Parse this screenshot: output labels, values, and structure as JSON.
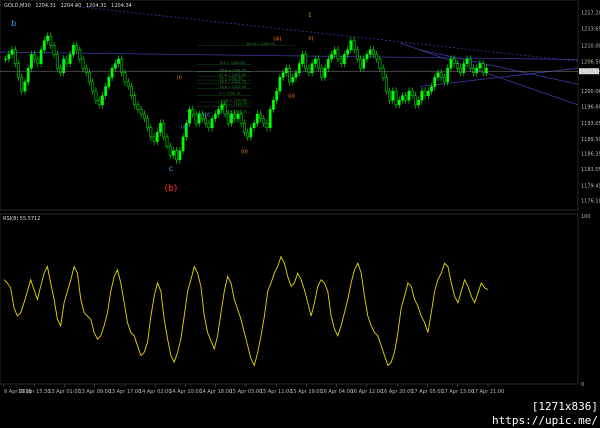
{
  "window": {
    "symbol_label": "GOLD,M30",
    "ohlc": [
      "1204.31",
      "1204.40",
      "1204.31",
      "1204.34"
    ]
  },
  "indicator": {
    "label": "RSI(8) 55.5712",
    "top_label": "100",
    "bottom_label": "0"
  },
  "colors": {
    "background": "#000000",
    "candles": "#00ff00",
    "rsi": "#e8d800",
    "trendline": "#3a3aa0",
    "wave_blue": "#3aa0ff",
    "wave_orange": "#ff8c1a",
    "wave_red": "#ff2b2b",
    "wave_yellow": "#f2e400",
    "fib": "#2e8b2e"
  },
  "chart_data": {
    "type": "candlestick",
    "y_axis_ticks": [
      "1217.20",
      "1213.65",
      "1210.00",
      "1206.50",
      "1204.34",
      "1200.06",
      "1196.60",
      "1193.05",
      "1189.50",
      "1186.35",
      "1183.05",
      "1179.45",
      "1176.10"
    ],
    "ylim": [
      1174.5,
      1219.0
    ],
    "x_axis_ticks": [
      "9 Apr 2015",
      "10 Apr 15:30",
      "13 Apr 01:00",
      "13 Apr 09:00",
      "13 Apr 17:00",
      "14 Apr 02:00",
      "14 Apr 10:00",
      "14 Apr 18:00",
      "15 Apr 03:00",
      "15 Apr 11:00",
      "15 Apr 19:00",
      "16 Apr 04:00",
      "16 Apr 12:00",
      "16 Apr 20:00",
      "17 Apr 05:00",
      "17 Apr 13:00",
      "17 Apr 21:00"
    ],
    "current_price": 1204.34,
    "wave_labels": [
      {
        "text": "b",
        "color": "wave_blue",
        "price": 1214.2,
        "t": 0.02
      },
      {
        "text": "c",
        "color": "wave_blue",
        "price": 1182.6,
        "t": 0.345
      },
      {
        "text": "(b)",
        "color": "wave_red",
        "price": 1178.2,
        "t": 0.345
      },
      {
        "text": "1",
        "color": "wave_yellow",
        "price": 1216.3,
        "t": 0.632
      },
      {
        "text": "(iii)",
        "color": "wave_orange",
        "price": 1211.0,
        "t": 0.565
      },
      {
        "text": "(i)",
        "color": "wave_orange",
        "price": 1211.2,
        "t": 0.634
      },
      {
        "text": "(ii)",
        "color": "wave_orange",
        "price": 1198.6,
        "t": 0.594
      },
      {
        "text": "(i)",
        "color": "wave_orange",
        "price": 1202.6,
        "t": 0.362
      },
      {
        "text": "(ii)",
        "color": "wave_orange",
        "price": 1186.5,
        "t": 0.497
      },
      {
        "text": "(a)",
        "color": "wave_blue",
        "price": 1191.8,
        "t": 0.372
      },
      {
        "text": "(b)",
        "color": "wave_blue",
        "price": 1194.5,
        "t": 0.418
      }
    ],
    "fib_levels": [
      {
        "label": "161.8 = 1209.90",
        "price": 1209.9
      },
      {
        "label": "100 = 1205.80",
        "price": 1205.8
      },
      {
        "label": "76.4 = 1204.20",
        "price": 1204.2
      },
      {
        "label": "61.8 = 1203.20",
        "price": 1203.2
      },
      {
        "label": "50 = 1202.40",
        "price": 1202.4
      },
      {
        "label": "38.2 = 1201.70",
        "price": 1201.7
      },
      {
        "label": "23.6 = 1200.60",
        "price": 1200.6
      },
      {
        "label": "0 = 1199.10",
        "price": 1199.1
      },
      {
        "label": "-23.6 = 1197.60",
        "price": 1197.6
      },
      {
        "label": "-38.2 = 1196.70",
        "price": 1196.7
      },
      {
        "label": "-61.8 = 1195.20",
        "price": 1195.2
      }
    ],
    "price_series": [
      1207,
      1208,
      1209,
      1206,
      1203,
      1200,
      1202,
      1205,
      1208,
      1207,
      1206,
      1209,
      1211,
      1212,
      1210,
      1208,
      1205,
      1204,
      1207,
      1206,
      1208,
      1210,
      1209,
      1207,
      1205,
      1204,
      1202,
      1200,
      1198,
      1197,
      1199,
      1201,
      1203,
      1205,
      1206,
      1207,
      1204,
      1202,
      1201,
      1199,
      1197,
      1196,
      1195,
      1194,
      1192,
      1190,
      1189,
      1191,
      1193,
      1190,
      1188,
      1186,
      1187,
      1185,
      1187,
      1190,
      1193,
      1196,
      1195,
      1193,
      1195,
      1194,
      1193,
      1192,
      1194,
      1195,
      1196,
      1197,
      1195,
      1193,
      1195,
      1194,
      1195,
      1193,
      1191,
      1190,
      1192,
      1193,
      1195,
      1194,
      1193,
      1192,
      1196,
      1198,
      1200,
      1203,
      1204,
      1205,
      1202,
      1203,
      1204,
      1206,
      1208,
      1205,
      1204,
      1206,
      1207,
      1205,
      1203,
      1205,
      1207,
      1208,
      1209,
      1207,
      1206,
      1208,
      1209,
      1211,
      1209,
      1207,
      1205,
      1207,
      1208,
      1209,
      1208,
      1207,
      1205,
      1203,
      1200,
      1198,
      1200,
      1197,
      1198,
      1199,
      1198,
      1200,
      1199,
      1197,
      1198,
      1200,
      1199,
      1200,
      1201,
      1203,
      1204,
      1203,
      1202,
      1205,
      1207,
      1206,
      1205,
      1204,
      1206,
      1207,
      1205,
      1204,
      1205,
      1206,
      1204,
      1205
    ],
    "rsi_series": [
      62,
      60,
      57,
      45,
      40,
      42,
      48,
      55,
      62,
      56,
      50,
      58,
      66,
      70,
      60,
      50,
      38,
      34,
      48,
      55,
      62,
      70,
      66,
      50,
      42,
      40,
      38,
      30,
      26,
      28,
      34,
      42,
      55,
      64,
      68,
      60,
      48,
      36,
      30,
      28,
      22,
      16,
      18,
      24,
      40,
      52,
      60,
      55,
      38,
      26,
      16,
      12,
      18,
      26,
      40,
      55,
      62,
      70,
      66,
      58,
      40,
      30,
      25,
      20,
      28,
      42,
      55,
      64,
      60,
      50,
      44,
      38,
      30,
      22,
      14,
      10,
      18,
      28,
      40,
      55,
      60,
      66,
      70,
      76,
      72,
      64,
      58,
      60,
      66,
      62,
      56,
      48,
      40,
      48,
      58,
      62,
      60,
      55,
      40,
      32,
      28,
      34,
      42,
      50,
      60,
      68,
      72,
      66,
      52,
      40,
      34,
      30,
      28,
      22,
      16,
      10,
      12,
      18,
      30,
      45,
      52,
      60,
      58,
      50,
      46,
      40,
      36,
      30,
      42,
      55,
      62,
      66,
      72,
      70,
      60,
      52,
      48,
      55,
      62,
      58,
      52,
      48,
      54,
      60,
      57,
      56
    ]
  }
}
